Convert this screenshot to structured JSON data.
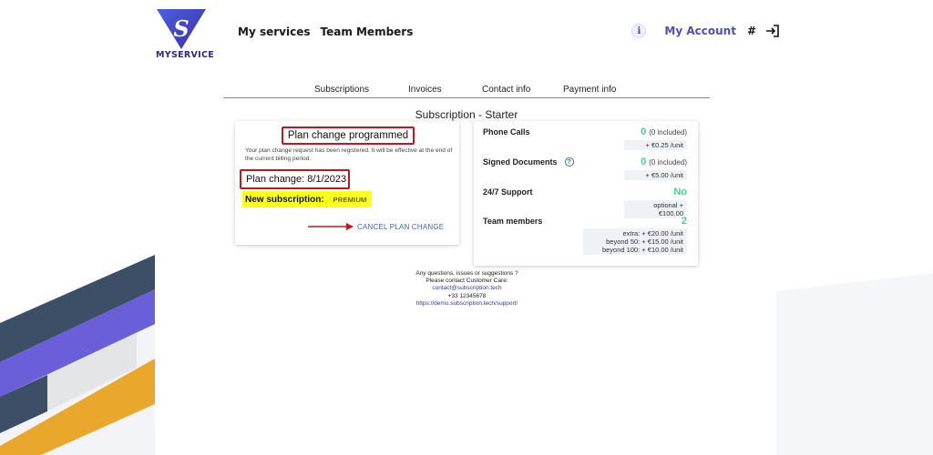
{
  "brand": {
    "logo_letter": "S",
    "name_part1": "MY",
    "name_part2": "SERVICE",
    "color_primary": "#4a52b5",
    "color_accent": "#6a5fd8"
  },
  "header": {
    "nav": [
      "My services",
      "Team Members"
    ],
    "info_icon": "i",
    "account_label": "My Account",
    "hash": "#",
    "icons": [
      "info-icon",
      "logout-icon"
    ]
  },
  "tabs": [
    "Subscriptions",
    "Invoices",
    "Contact info",
    "Payment info"
  ],
  "subscription_title": "Subscription - Starter",
  "plan_card": {
    "title": "Plan change programmed",
    "description": "Your plan change request has been registered. It will be effective at the end of the current billing period.",
    "plan_change": "Plan change: 8/1/2023",
    "new_sub_label": "New subscription:",
    "new_sub_value": "PREMIUM",
    "cancel_label": "CANCEL PLAN CHANGE",
    "highlight_color": "#c8141e",
    "marker_color": "#ffff1e"
  },
  "features": [
    {
      "label": "Phone Calls",
      "value": "0",
      "included": "(0 included)",
      "prices": [
        "+ €0.25 /unit"
      ]
    },
    {
      "label": "Signed Documents",
      "help": "?",
      "value": "0",
      "included": "(0 included)",
      "prices": [
        "+ €5.00 /unit"
      ]
    },
    {
      "label": "24/7 Support",
      "value": "No",
      "included": "",
      "prices": [
        "optional + €100.00"
      ]
    },
    {
      "label": "Team members",
      "value": "2",
      "included": "",
      "prices": [
        "extra: + €20.00 /unit",
        "beyond 50: + €15.00 /unit",
        "beyond 100: + €10.00 /unit"
      ]
    }
  ],
  "value_color": "#4bd08e",
  "footer": {
    "line1": "Any questions, issues or suggestions ?",
    "line2": "Please contact Customer Care:",
    "email": "contact@subscription.tech",
    "phone": "+33 12345678",
    "url": "https://demo.subscription.tech/support/"
  }
}
